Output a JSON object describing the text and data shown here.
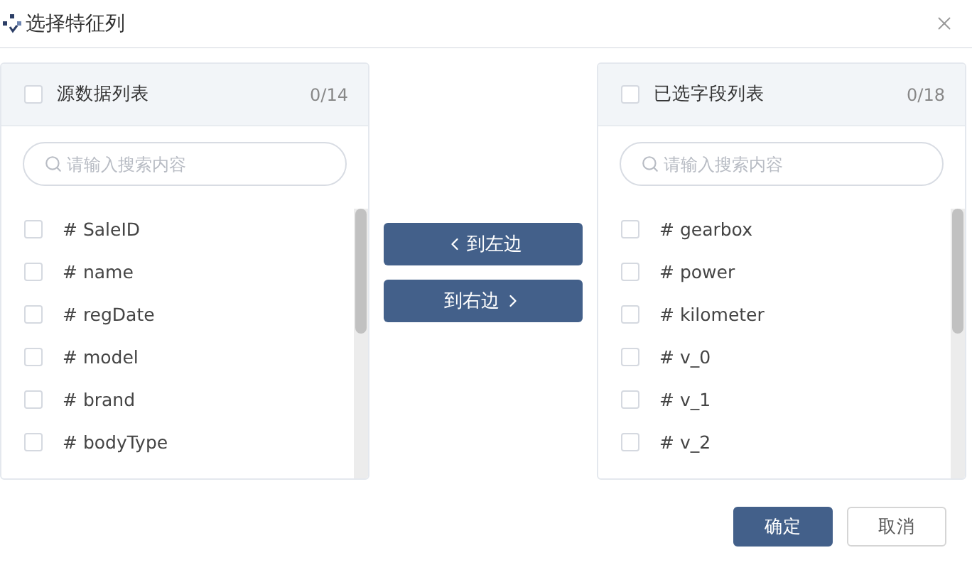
{
  "dialog": {
    "title": "选择特征列"
  },
  "source_panel": {
    "title": "源数据列表",
    "checked": false,
    "count": "0/14",
    "search": {
      "placeholder": "请输入搜索内容"
    },
    "items": [
      {
        "label": "# SaleID",
        "checked": false
      },
      {
        "label": "# name",
        "checked": false
      },
      {
        "label": "# regDate",
        "checked": false
      },
      {
        "label": "# model",
        "checked": false
      },
      {
        "label": "# brand",
        "checked": false
      },
      {
        "label": "# bodyType",
        "checked": false
      }
    ]
  },
  "transfer_buttons": [
    {
      "label": "到左边",
      "kind": "left"
    },
    {
      "label": "到右边",
      "kind": "right"
    }
  ],
  "target_panel": {
    "title": "已选字段列表",
    "checked": false,
    "count": "0/18",
    "search": {
      "placeholder": "请输入搜索内容"
    },
    "items": [
      {
        "label": "# gearbox",
        "checked": false
      },
      {
        "label": "# power",
        "checked": false
      },
      {
        "label": "# kilometer",
        "checked": false
      },
      {
        "label": "# v_0",
        "checked": false
      },
      {
        "label": "# v_1",
        "checked": false
      },
      {
        "label": "# v_2",
        "checked": false
      }
    ]
  },
  "footer_buttons": [
    {
      "label": "确定",
      "kind": "primary"
    },
    {
      "label": "取消",
      "kind": "default"
    }
  ]
}
